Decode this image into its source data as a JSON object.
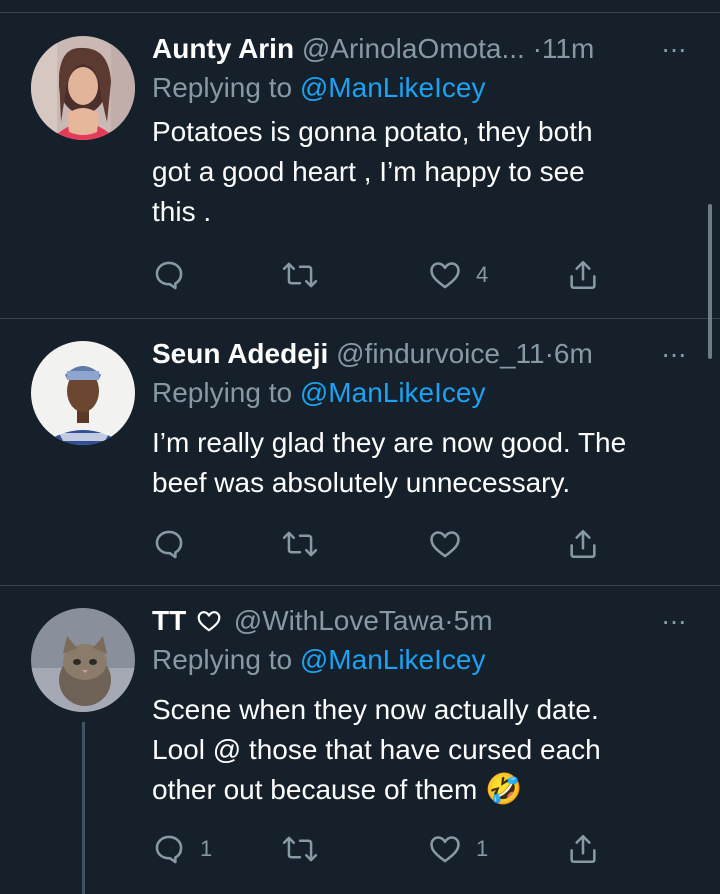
{
  "tweets": [
    {
      "name": "Aunty Arin",
      "handle": "@ArinolaOmota...",
      "time": "·11m",
      "more": "···",
      "replying_prefix": "Replying to ",
      "replying_to": "@ManLikeIcey",
      "text": "Potatoes is gonna potato, they both\ngot a good heart , I’m happy to see\nthis .",
      "reply_count": "",
      "retweet_count": "",
      "like_count": "4"
    },
    {
      "name": "Seun Adedeji",
      "handle": "@findurvoice_11",
      "time": "·6m",
      "more": "···",
      "replying_prefix": "Replying to ",
      "replying_to": "@ManLikeIcey",
      "text": "I’m really glad they are now good. The\nbeef was absolutely unnecessary.",
      "reply_count": "",
      "retweet_count": "",
      "like_count": ""
    },
    {
      "name": "TT",
      "handle": "@WithLoveTawa",
      "time": "·5m",
      "more": "···",
      "replying_prefix": "Replying to ",
      "replying_to": "@ManLikeIcey",
      "text": "Scene when they now actually date.\nLool @ those that have cursed each\nother out because of them",
      "emoji": "🤣",
      "reply_count": "1",
      "retweet_count": "",
      "like_count": "1"
    }
  ],
  "colors": {
    "background": "#15202b",
    "divider": "#38444d",
    "secondary_text": "#8899a6",
    "link": "#1da1f2"
  },
  "icons": {
    "reply": "reply-bubble-icon",
    "retweet": "retweet-icon",
    "like": "heart-outline-icon",
    "share": "share-upload-icon",
    "more": "more-dots-icon",
    "name_heart": "heart-outline-icon"
  }
}
